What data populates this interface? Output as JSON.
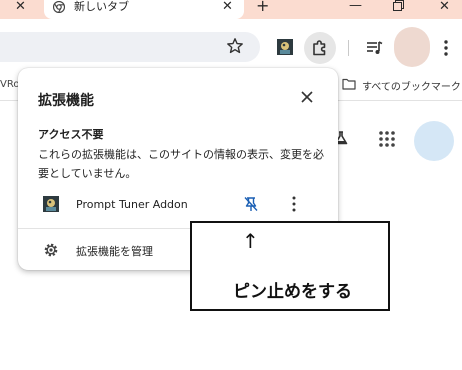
{
  "browser": {
    "tabs": [
      {
        "label": "",
        "close_glyph": "✕"
      },
      {
        "label": "新しいタブ",
        "close_glyph": "✕",
        "active": true
      }
    ],
    "new_tab_glyph": "+",
    "window_controls": {
      "minimize": "—",
      "close": "✕"
    },
    "accent_tabstrip": "#fbdcd0",
    "bookmarks": {
      "left_fragment": "VRo",
      "all_bookmarks": "すべてのブックマーク"
    }
  },
  "extensions_popup": {
    "title": "拡張機能",
    "access_section": {
      "heading": "アクセス不要",
      "description": "これらの拡張機能は、このサイトの情報の表示、変更を必要としていません。"
    },
    "extensions": [
      {
        "name": "Prompt Tuner Addon",
        "pin_icon": "pin-off-icon",
        "menu_icon": "more-vert-icon"
      }
    ],
    "manage_label": "拡張機能を管理"
  },
  "annotation": {
    "arrow": "↑",
    "text": "ピン止めをする"
  }
}
